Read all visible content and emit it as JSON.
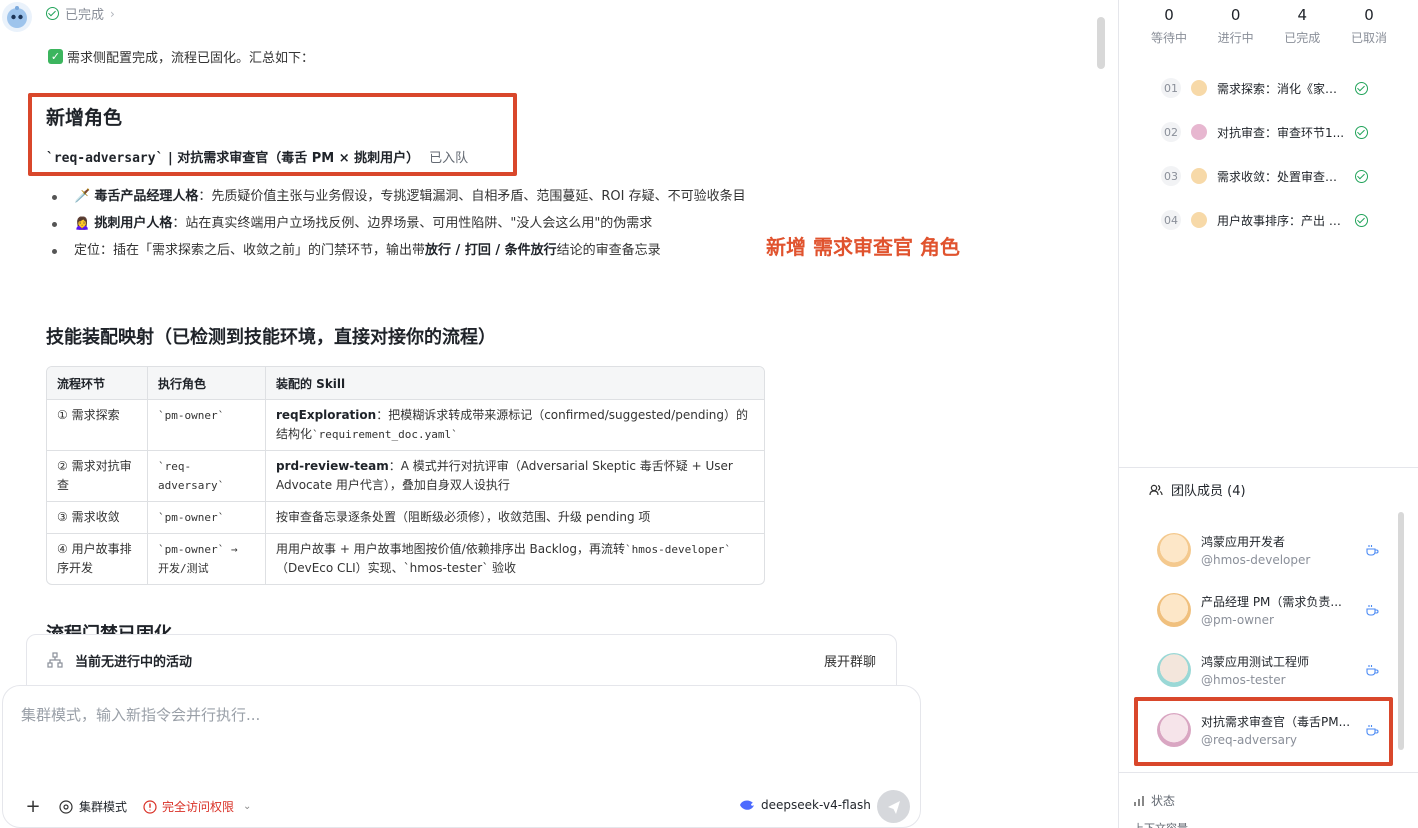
{
  "status": {
    "label": "已完成"
  },
  "summary": {
    "text": "需求侧配置完成，流程已固化。汇总如下："
  },
  "new_role": {
    "heading": "新增角色",
    "code": "`req-adversary`",
    "separator": "|",
    "title": "对抗需求审查官（毒舌 PM × 挑刺用户）",
    "tag": "已入队"
  },
  "bullets": [
    {
      "emoji": "🗡️",
      "bold": "毒舌产品经理人格",
      "text": "：先质疑价值主张与业务假设，专挑逻辑漏洞、自相矛盾、范围蔓延、ROI 存疑、不可验收条目"
    },
    {
      "emoji": "🙍‍♀️",
      "bold": "挑刺用户人格",
      "text": "：站在真实终端用户立场找反例、边界场景、可用性陷阱、\"没人会这么用\"的伪需求"
    },
    {
      "pre": "定位：插在「需求探索之后、收敛之前」的门禁环节，输出带",
      "b1": "放行 / 打回 / 条件放行",
      "post": "结论的审查备忘录"
    }
  ],
  "annotation": "新增 需求审查官 角色",
  "skills": {
    "title": "技能装配映射（已检测到技能环境，直接对接你的流程）",
    "headers": [
      "流程环节",
      "执行角色",
      "装配的 Skill"
    ],
    "rows": [
      {
        "stage": "① 需求探索",
        "role": "`pm-owner`",
        "skill": "reqExploration",
        "desc1": "：把模糊诉求转成带来源标记（confirmed/suggested/pending）的结构化",
        "code": "`requirement_doc.yaml`",
        "desc2": ""
      },
      {
        "stage": "② 需求对抗审查",
        "role": "`req-adversary`",
        "skill": "prd-review-team",
        "desc1": "：A 模式并行对抗评审（Adversarial Skeptic 毒舌怀疑 + User Advocate 用户代言），叠加自身双人设执行",
        "code": "",
        "desc2": ""
      },
      {
        "stage": "③ 需求收敛",
        "role": "`pm-owner`",
        "skill": "",
        "desc1": "按审查备忘录逐条处置（阻断级必须修），收敛范围、升级 pending 项",
        "code": "",
        "desc2": ""
      },
      {
        "stage": "④ 用户故事排序开发",
        "role": "`pm-owner` → 开发/测试",
        "skill": "",
        "desc1": "用用户故事 + 用户故事地图按价值/依赖排序出 Backlog，再流转",
        "code": "`hmos-developer`",
        "desc2": "（DevEco CLI）实现、`hmos-tester` 验收"
      }
    ]
  },
  "next_section": "流程门禁已固化",
  "activity": {
    "label": "当前无进行中的活动",
    "expand": "展开群聊"
  },
  "composer": {
    "placeholder": "集群模式，输入新指令会并行执行...",
    "mode": "集群模式",
    "permission": "完全访问权限",
    "model": "deepseek-v4-flash"
  },
  "panel": {
    "stats": [
      {
        "num": "0",
        "label": "等待中"
      },
      {
        "num": "0",
        "label": "进行中"
      },
      {
        "num": "4",
        "label": "已完成"
      },
      {
        "num": "0",
        "label": "已取消"
      }
    ],
    "tasks": [
      {
        "idx": "01",
        "text": "需求探索：消化《家谱..."
      },
      {
        "idx": "02",
        "text": "对抗审查：审查环节1..."
      },
      {
        "idx": "03",
        "text": "需求收敛：处置审查备..."
      },
      {
        "idx": "04",
        "text": "用户故事排序：产出 M..."
      }
    ],
    "team_title": "团队成员 (4)",
    "members": [
      {
        "name": "鸿蒙应用开发者",
        "handle": "@hmos-developer"
      },
      {
        "name": "产品经理 PM（需求负责...",
        "handle": "@pm-owner"
      },
      {
        "name": "鸿蒙应用测试工程师",
        "handle": "@hmos-tester"
      },
      {
        "name": "对抗需求审查官（毒舌PM...",
        "handle": "@req-adversary"
      }
    ],
    "state_title": "状态",
    "state_row": "上下文容量"
  },
  "colors": {
    "accent_red": "#d9472b",
    "success": "#22a35a",
    "annotation": "#e0532e"
  }
}
